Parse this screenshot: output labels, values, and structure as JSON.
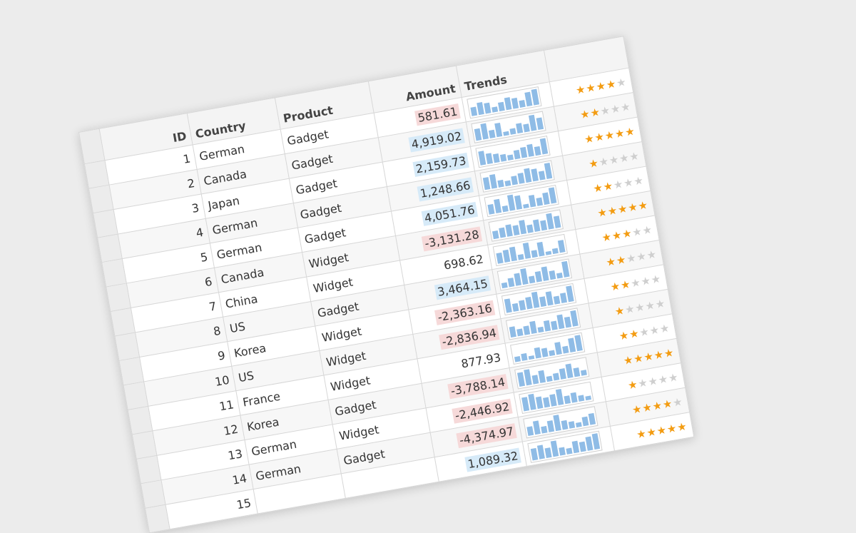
{
  "columns": {
    "id": "ID",
    "country": "Country",
    "product": "Product",
    "amount": "Amount",
    "trends": "Trends"
  },
  "colors": {
    "positive_bg": "#d6eaf8",
    "negative_bg": "#f6d9d9",
    "spark_bar": "#8fbce6",
    "star_on": "#f39c12",
    "star_off": "#cfcfcf"
  },
  "rows": [
    {
      "id": "1",
      "country": "German",
      "product": "Gadget",
      "amount": "581.61",
      "tone": "neg",
      "rating": 4,
      "trend": [
        5,
        7,
        6,
        3,
        5,
        7,
        6,
        4,
        8,
        9
      ]
    },
    {
      "id": "2",
      "country": "Canada",
      "product": "Gadget",
      "amount": "4,919.02",
      "tone": "pos",
      "rating": 2,
      "trend": [
        6,
        8,
        4,
        7,
        2,
        3,
        5,
        4,
        8,
        6
      ]
    },
    {
      "id": "3",
      "country": "Japan",
      "product": "Gadget",
      "amount": "2,159.73",
      "tone": "pos",
      "rating": 5,
      "trend": [
        8,
        6,
        5,
        4,
        3,
        5,
        6,
        7,
        5,
        9
      ]
    },
    {
      "id": "4",
      "country": "German",
      "product": "Gadget",
      "amount": "1,248.66",
      "tone": "pos",
      "rating": 1,
      "trend": [
        7,
        8,
        4,
        3,
        5,
        6,
        8,
        7,
        5,
        9
      ]
    },
    {
      "id": "5",
      "country": "German",
      "product": "Gadget",
      "amount": "4,051.76",
      "tone": "pos",
      "rating": 2,
      "trend": [
        5,
        7,
        3,
        8,
        7,
        2,
        6,
        4,
        6,
        8
      ]
    },
    {
      "id": "6",
      "country": "Canada",
      "product": "Widget",
      "amount": "-3,131.28",
      "tone": "neg",
      "rating": 5,
      "trend": [
        4,
        5,
        6,
        5,
        7,
        4,
        6,
        5,
        8,
        6
      ]
    },
    {
      "id": "7",
      "country": "China",
      "product": "Widget",
      "amount": "698.62",
      "tone": "mid",
      "rating": 3,
      "trend": [
        6,
        7,
        8,
        3,
        9,
        4,
        8,
        2,
        3,
        7
      ]
    },
    {
      "id": "8",
      "country": "US",
      "product": "Gadget",
      "amount": "3,464.15",
      "tone": "pos",
      "rating": 2,
      "trend": [
        3,
        5,
        7,
        9,
        4,
        6,
        8,
        5,
        3,
        9
      ]
    },
    {
      "id": "9",
      "country": "Korea",
      "product": "Widget",
      "amount": "-2,363.16",
      "tone": "neg",
      "rating": 2,
      "trend": [
        7,
        4,
        5,
        6,
        8,
        5,
        7,
        4,
        5,
        8
      ]
    },
    {
      "id": "10",
      "country": "US",
      "product": "Widget",
      "amount": "-2,836.94",
      "tone": "neg",
      "rating": 1,
      "trend": [
        6,
        4,
        5,
        7,
        3,
        6,
        5,
        8,
        6,
        9
      ]
    },
    {
      "id": "11",
      "country": "France",
      "product": "Widget",
      "amount": "877.93",
      "tone": "mid",
      "rating": 2,
      "trend": [
        3,
        4,
        2,
        6,
        5,
        3,
        7,
        4,
        8,
        9
      ]
    },
    {
      "id": "12",
      "country": "Korea",
      "product": "Gadget",
      "amount": "-3,788.14",
      "tone": "neg",
      "rating": 5,
      "trend": [
        8,
        9,
        5,
        7,
        3,
        4,
        6,
        8,
        5,
        3
      ]
    },
    {
      "id": "13",
      "country": "German",
      "product": "Widget",
      "amount": "-2,446.92",
      "tone": "neg",
      "rating": 1,
      "trend": [
        7,
        8,
        6,
        5,
        6,
        8,
        4,
        5,
        3,
        2
      ]
    },
    {
      "id": "14",
      "country": "German",
      "product": "Gadget",
      "amount": "-4,374.97",
      "tone": "neg",
      "rating": 4,
      "trend": [
        4,
        6,
        3,
        5,
        7,
        4,
        3,
        2,
        4,
        5
      ]
    },
    {
      "id": "15",
      "country": "",
      "product": "",
      "amount": "1,089.32",
      "tone": "pos",
      "rating": 5,
      "trend": [
        6,
        7,
        5,
        8,
        4,
        3,
        6,
        5,
        7,
        8
      ]
    }
  ]
}
